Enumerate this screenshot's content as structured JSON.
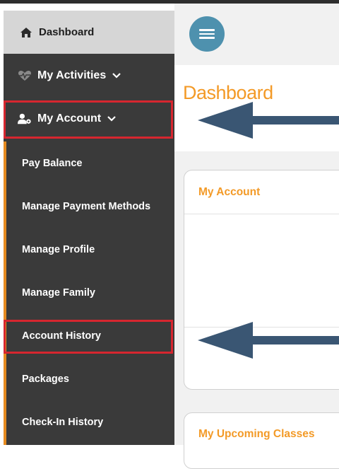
{
  "sidebar": {
    "dashboard_label": "Dashboard",
    "activities_label": "My Activities",
    "account_label": "My Account",
    "submenu": [
      "Pay Balance",
      "Manage Payment Methods",
      "Manage Profile",
      "Manage Family",
      "Account History",
      "Packages",
      "Check-In History"
    ]
  },
  "main": {
    "page_title": "Dashboard",
    "cards": {
      "account_title": "My Account",
      "classes_title": "My Upcoming Classes"
    }
  },
  "colors": {
    "accent_orange": "#f39a27",
    "sidebar_bg": "#3a3a3a",
    "highlight_red": "#d6262f",
    "arrow_navy": "#3a5673",
    "menu_button": "#4e91ae"
  },
  "icons": {
    "dashboard": "home-icon",
    "activities": "heartbeat-icon",
    "account": "user-gear-icon",
    "menu": "hamburger-menu-icon",
    "expand": "chevron-down-icon"
  }
}
